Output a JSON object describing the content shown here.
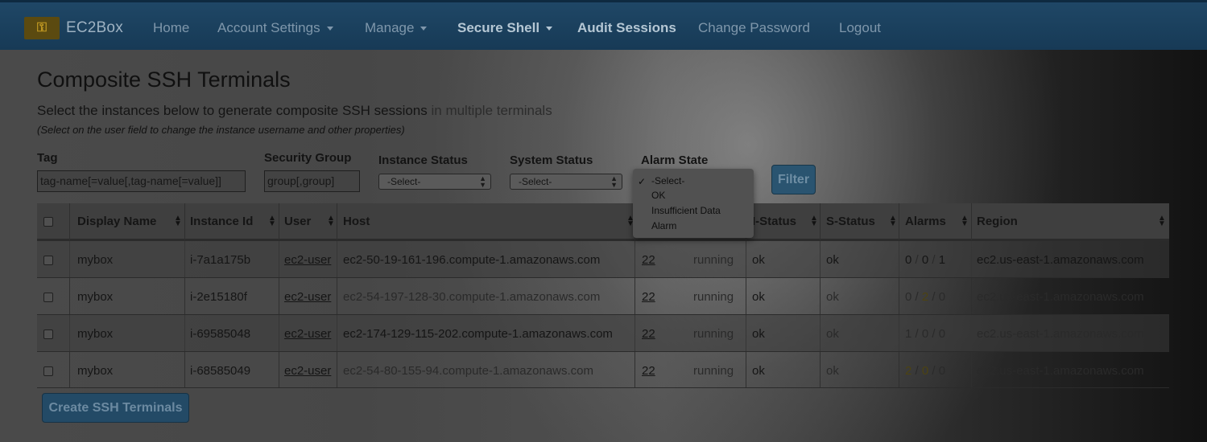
{
  "navbar": {
    "brand": "EC2Box",
    "items": [
      {
        "label": "Home",
        "dropdown": false
      },
      {
        "label": "Account Settings",
        "dropdown": true
      },
      {
        "label": "Manage",
        "dropdown": true
      },
      {
        "label": "Secure Shell",
        "dropdown": true
      },
      {
        "label": "Audit Sessions",
        "dropdown": false
      },
      {
        "label": "Change Password",
        "dropdown": false
      },
      {
        "label": "Logout",
        "dropdown": false
      }
    ]
  },
  "page": {
    "title": "Composite SSH Terminals",
    "subtitle_main": "Select the instances below to generate composite SSH sessions",
    "subtitle_muted": " in multiple terminals",
    "note": "(Select on the user field to change the instance username and other properties)"
  },
  "filters": {
    "tag_label": "Tag",
    "tag_placeholder": "tag-name[=value[,tag-name[=value]]",
    "security_group_label": "Security Group",
    "security_group_placeholder": "group[,group]",
    "instance_status_label": "Instance Status",
    "instance_status_value": "-Select-",
    "system_status_label": "System Status",
    "system_status_value": "-Select-",
    "alarm_state_label": "Alarm State",
    "alarm_state_options": [
      "-Select-",
      "OK",
      "Insufficient Data",
      "Alarm"
    ],
    "alarm_state_selected": "-Select-",
    "filter_button": "Filter"
  },
  "table": {
    "columns": [
      "Display Name",
      "Instance Id",
      "User",
      "Host",
      "I-Status",
      "S-Status",
      "Alarms",
      "Region"
    ],
    "rows": [
      {
        "display_name": "mybox",
        "instance_id": "i-7a1a175b",
        "user": "ec2-user",
        "host": "ec2-50-19-161-196.compute-1.amazonaws.com",
        "port": "22",
        "state": "running",
        "i_status": "ok",
        "s_status": "ok",
        "alarms": [
          "0",
          "0",
          "1"
        ],
        "region": "ec2.us-east-1.amazonaws.com"
      },
      {
        "display_name": "mybox",
        "instance_id": "i-2e15180f",
        "user": "ec2-user",
        "host": "ec2-54-197-128-30.compute-1.amazonaws.com",
        "port": "22",
        "state": "running",
        "i_status": "ok",
        "s_status": "ok",
        "alarms": [
          "0",
          "2",
          "0"
        ],
        "region": "ec2.us-east-1.amazonaws.com"
      },
      {
        "display_name": "mybox",
        "instance_id": "i-69585048",
        "user": "ec2-user",
        "host": "ec2-174-129-115-202.compute-1.amazonaws.com",
        "port": "22",
        "state": "running",
        "i_status": "ok",
        "s_status": "ok",
        "alarms": [
          "1",
          "0",
          "0"
        ],
        "region": "ec2.us-east-1.amazonaws.com"
      },
      {
        "display_name": "mybox",
        "instance_id": "i-68585049",
        "user": "ec2-user",
        "host": "ec2-54-80-155-94.compute-1.amazonaws.com",
        "port": "22",
        "state": "running",
        "i_status": "ok",
        "s_status": "ok",
        "alarms": [
          "2",
          "0",
          "0"
        ],
        "region": "ec2.us-east-1.amazonaws.com"
      }
    ]
  },
  "create_button": "Create SSH Terminals",
  "colors": {
    "navbar": "#1f4766",
    "button": "#2a5470",
    "overlay": "#3a3a3a"
  }
}
